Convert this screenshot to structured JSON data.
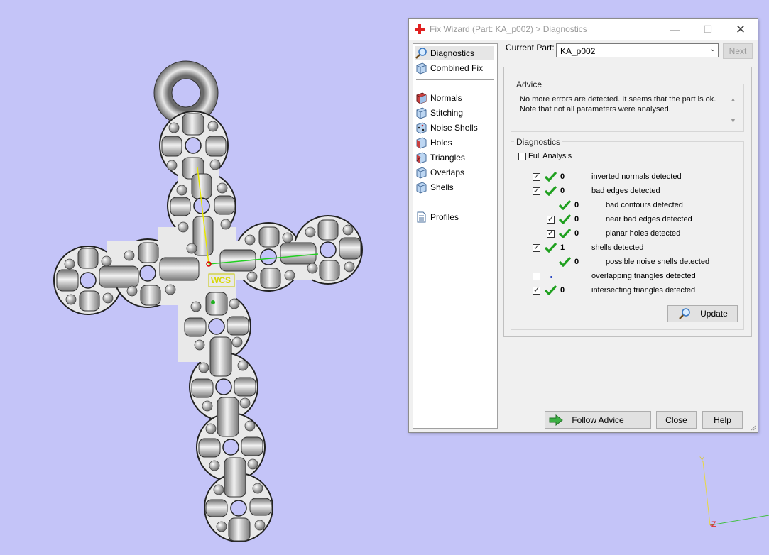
{
  "window": {
    "title": "Fix Wizard (Part: KA_p002) > Diagnostics"
  },
  "sidebar": {
    "items": [
      {
        "label": "Diagnostics",
        "icon": "magnifier-icon",
        "selected": true
      },
      {
        "label": "Combined Fix",
        "icon": "combined-fix-icon"
      },
      {
        "label": "Normals",
        "icon": "normals-icon"
      },
      {
        "label": "Stitching",
        "icon": "stitching-icon"
      },
      {
        "label": "Noise Shells",
        "icon": "noise-shells-icon"
      },
      {
        "label": "Holes",
        "icon": "holes-icon"
      },
      {
        "label": "Triangles",
        "icon": "triangles-icon"
      },
      {
        "label": "Overlaps",
        "icon": "overlaps-icon"
      },
      {
        "label": "Shells",
        "icon": "shells-icon"
      },
      {
        "label": "Profiles",
        "icon": "profiles-icon"
      }
    ]
  },
  "part": {
    "label": "Current Part:",
    "value": "KA_p002",
    "next_label": "Next"
  },
  "advice": {
    "label": "Advice",
    "line1": "No more errors are detected. It seems that the part is ok.",
    "line2": "Note that not all parameters were analysed."
  },
  "diagnostics": {
    "label": "Diagnostics",
    "full_analysis_label": "Full Analysis",
    "rows": [
      {
        "checkbox": "checked",
        "status": "ok",
        "count": "0",
        "label": "inverted normals detected"
      },
      {
        "checkbox": "checked",
        "status": "ok",
        "count": "0",
        "label": "bad edges detected"
      },
      {
        "checkbox": "none",
        "status": "ok",
        "count": "0",
        "label": "bad contours detected"
      },
      {
        "checkbox": "checked",
        "status": "ok",
        "count": "0",
        "label": "near bad edges detected"
      },
      {
        "checkbox": "checked",
        "status": "ok",
        "count": "0",
        "label": "planar holes detected"
      },
      {
        "checkbox": "checked",
        "status": "ok",
        "count": "1",
        "label": "shells detected"
      },
      {
        "checkbox": "none",
        "status": "ok",
        "count": "0",
        "label": "possible noise shells detected"
      },
      {
        "checkbox": "unchecked",
        "status": "dot",
        "count": "",
        "label": "overlapping triangles detected"
      },
      {
        "checkbox": "checked",
        "status": "ok",
        "count": "0",
        "label": "intersecting triangles detected"
      }
    ],
    "update_label": "Update"
  },
  "buttons": {
    "follow_advice": "Follow Advice",
    "close": "Close",
    "help": "Help"
  },
  "viewport": {
    "wcs_label": "WCS",
    "axis_y_label": "Y",
    "axis_z_label": "Z",
    "background_color": "#c4c4f8"
  }
}
